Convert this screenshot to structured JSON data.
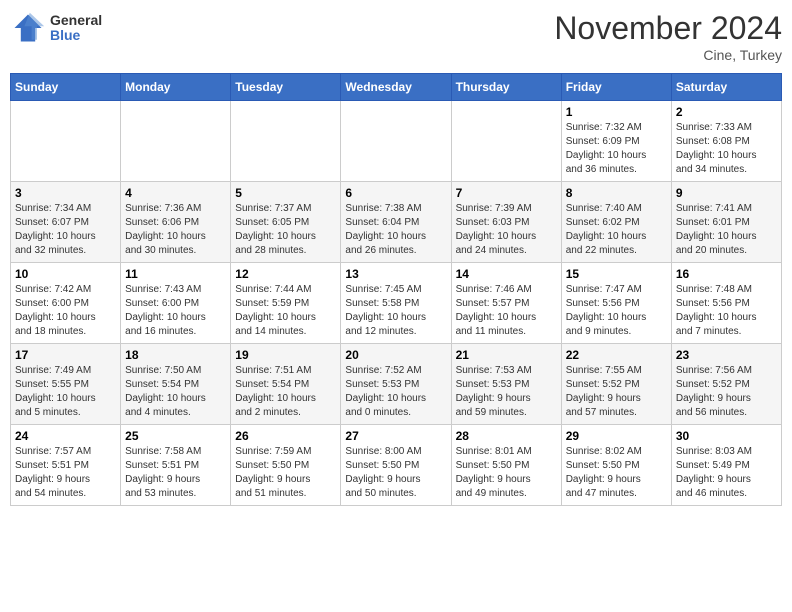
{
  "header": {
    "logo": {
      "general": "General",
      "blue": "Blue"
    },
    "title": "November 2024",
    "location": "Cine, Turkey"
  },
  "calendar": {
    "weekdays": [
      "Sunday",
      "Monday",
      "Tuesday",
      "Wednesday",
      "Thursday",
      "Friday",
      "Saturday"
    ],
    "weeks": [
      [
        {
          "day": "",
          "info": ""
        },
        {
          "day": "",
          "info": ""
        },
        {
          "day": "",
          "info": ""
        },
        {
          "day": "",
          "info": ""
        },
        {
          "day": "",
          "info": ""
        },
        {
          "day": "1",
          "info": "Sunrise: 7:32 AM\nSunset: 6:09 PM\nDaylight: 10 hours\nand 36 minutes."
        },
        {
          "day": "2",
          "info": "Sunrise: 7:33 AM\nSunset: 6:08 PM\nDaylight: 10 hours\nand 34 minutes."
        }
      ],
      [
        {
          "day": "3",
          "info": "Sunrise: 7:34 AM\nSunset: 6:07 PM\nDaylight: 10 hours\nand 32 minutes."
        },
        {
          "day": "4",
          "info": "Sunrise: 7:36 AM\nSunset: 6:06 PM\nDaylight: 10 hours\nand 30 minutes."
        },
        {
          "day": "5",
          "info": "Sunrise: 7:37 AM\nSunset: 6:05 PM\nDaylight: 10 hours\nand 28 minutes."
        },
        {
          "day": "6",
          "info": "Sunrise: 7:38 AM\nSunset: 6:04 PM\nDaylight: 10 hours\nand 26 minutes."
        },
        {
          "day": "7",
          "info": "Sunrise: 7:39 AM\nSunset: 6:03 PM\nDaylight: 10 hours\nand 24 minutes."
        },
        {
          "day": "8",
          "info": "Sunrise: 7:40 AM\nSunset: 6:02 PM\nDaylight: 10 hours\nand 22 minutes."
        },
        {
          "day": "9",
          "info": "Sunrise: 7:41 AM\nSunset: 6:01 PM\nDaylight: 10 hours\nand 20 minutes."
        }
      ],
      [
        {
          "day": "10",
          "info": "Sunrise: 7:42 AM\nSunset: 6:00 PM\nDaylight: 10 hours\nand 18 minutes."
        },
        {
          "day": "11",
          "info": "Sunrise: 7:43 AM\nSunset: 6:00 PM\nDaylight: 10 hours\nand 16 minutes."
        },
        {
          "day": "12",
          "info": "Sunrise: 7:44 AM\nSunset: 5:59 PM\nDaylight: 10 hours\nand 14 minutes."
        },
        {
          "day": "13",
          "info": "Sunrise: 7:45 AM\nSunset: 5:58 PM\nDaylight: 10 hours\nand 12 minutes."
        },
        {
          "day": "14",
          "info": "Sunrise: 7:46 AM\nSunset: 5:57 PM\nDaylight: 10 hours\nand 11 minutes."
        },
        {
          "day": "15",
          "info": "Sunrise: 7:47 AM\nSunset: 5:56 PM\nDaylight: 10 hours\nand 9 minutes."
        },
        {
          "day": "16",
          "info": "Sunrise: 7:48 AM\nSunset: 5:56 PM\nDaylight: 10 hours\nand 7 minutes."
        }
      ],
      [
        {
          "day": "17",
          "info": "Sunrise: 7:49 AM\nSunset: 5:55 PM\nDaylight: 10 hours\nand 5 minutes."
        },
        {
          "day": "18",
          "info": "Sunrise: 7:50 AM\nSunset: 5:54 PM\nDaylight: 10 hours\nand 4 minutes."
        },
        {
          "day": "19",
          "info": "Sunrise: 7:51 AM\nSunset: 5:54 PM\nDaylight: 10 hours\nand 2 minutes."
        },
        {
          "day": "20",
          "info": "Sunrise: 7:52 AM\nSunset: 5:53 PM\nDaylight: 10 hours\nand 0 minutes."
        },
        {
          "day": "21",
          "info": "Sunrise: 7:53 AM\nSunset: 5:53 PM\nDaylight: 9 hours\nand 59 minutes."
        },
        {
          "day": "22",
          "info": "Sunrise: 7:55 AM\nSunset: 5:52 PM\nDaylight: 9 hours\nand 57 minutes."
        },
        {
          "day": "23",
          "info": "Sunrise: 7:56 AM\nSunset: 5:52 PM\nDaylight: 9 hours\nand 56 minutes."
        }
      ],
      [
        {
          "day": "24",
          "info": "Sunrise: 7:57 AM\nSunset: 5:51 PM\nDaylight: 9 hours\nand 54 minutes."
        },
        {
          "day": "25",
          "info": "Sunrise: 7:58 AM\nSunset: 5:51 PM\nDaylight: 9 hours\nand 53 minutes."
        },
        {
          "day": "26",
          "info": "Sunrise: 7:59 AM\nSunset: 5:50 PM\nDaylight: 9 hours\nand 51 minutes."
        },
        {
          "day": "27",
          "info": "Sunrise: 8:00 AM\nSunset: 5:50 PM\nDaylight: 9 hours\nand 50 minutes."
        },
        {
          "day": "28",
          "info": "Sunrise: 8:01 AM\nSunset: 5:50 PM\nDaylight: 9 hours\nand 49 minutes."
        },
        {
          "day": "29",
          "info": "Sunrise: 8:02 AM\nSunset: 5:50 PM\nDaylight: 9 hours\nand 47 minutes."
        },
        {
          "day": "30",
          "info": "Sunrise: 8:03 AM\nSunset: 5:49 PM\nDaylight: 9 hours\nand 46 minutes."
        }
      ]
    ]
  }
}
